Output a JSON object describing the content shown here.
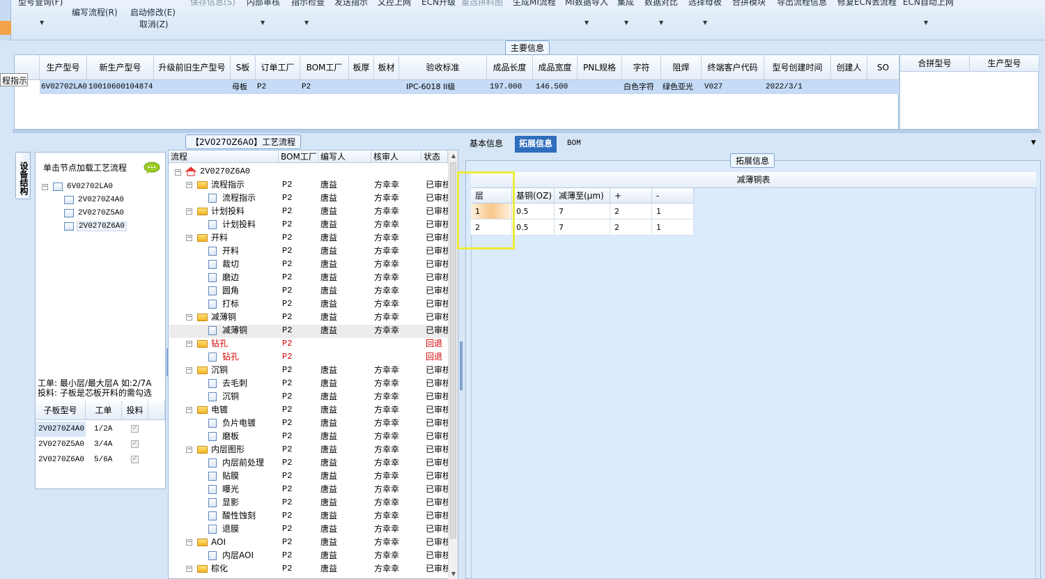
{
  "toolbar": {
    "items": [
      {
        "label": "型号查询(F)",
        "disabled": false
      },
      {
        "label": "编写流程(R)",
        "disabled": false
      },
      {
        "label": "启动修改(E)",
        "disabled": false
      },
      {
        "label": "取消(Z)",
        "disabled": false
      },
      {
        "label": "保存信息(S)",
        "disabled": true
      },
      {
        "label": "内部审核",
        "disabled": false
      },
      {
        "label": "指示检查",
        "disabled": false
      },
      {
        "label": "发送指示",
        "disabled": false
      },
      {
        "label": "文控上网",
        "disabled": false
      },
      {
        "label": "ECN升级",
        "disabled": false
      },
      {
        "label": "重选拼料图",
        "disabled": true
      },
      {
        "label": "生成MI流程",
        "disabled": false
      },
      {
        "label": "MI数据导入",
        "disabled": false
      },
      {
        "label": "集成",
        "disabled": false
      },
      {
        "label": "数据对比",
        "disabled": false
      },
      {
        "label": "选择母板",
        "disabled": false
      },
      {
        "label": "合拼模块",
        "disabled": false
      },
      {
        "label": "导出流程信息",
        "disabled": false
      },
      {
        "label": "修复ECN丢流程",
        "disabled": false
      },
      {
        "label": "ECN自动上网",
        "disabled": false
      }
    ]
  },
  "tooltip": "程指示",
  "main_section": {
    "title": "主要信息",
    "headers": [
      "生产型号",
      "新生产型号",
      "升级前旧生产型号",
      "S板",
      "订单工厂",
      "BOM工厂",
      "板厚",
      "板材",
      "验收标准",
      "成品长度",
      "成品宽度",
      "PNL规格",
      "字符",
      "阻焊",
      "终端客户代码",
      "型号创建时间",
      "创建人",
      "SO"
    ],
    "row": [
      "6V02702LA0",
      "10010600104874",
      "",
      "母板",
      "P2",
      "P2",
      "",
      "",
      "IPC-6018 II级",
      "197.000",
      "146.500",
      "",
      "白色字符",
      "绿色亚光",
      "V027",
      "2022/3/1",
      "",
      ""
    ]
  },
  "merge_section": {
    "headers": [
      "合拼型号",
      "生产型号"
    ]
  },
  "left_panel": {
    "tab_label": "设备结构",
    "load_label": "单击节点加载工艺流程",
    "tree": {
      "root": "6V02702LA0",
      "children": [
        "2V0270Z4A0",
        "2V0270Z5A0",
        "2V0270Z6A0"
      ]
    },
    "note_line1": "工单: 最小层/最大层A 如:2/7A",
    "note_line2": "投料: 子板是芯板开料的需勾选",
    "sub_headers": [
      "子板型号",
      "工单",
      "投料"
    ],
    "sub_rows": [
      {
        "model": "2V0270Z4A0",
        "order": "1/2A",
        "feed": true
      },
      {
        "model": "2V0270Z5A0",
        "order": "3/4A",
        "feed": true
      },
      {
        "model": "2V0270Z6A0",
        "order": "5/6A",
        "feed": true
      }
    ]
  },
  "flow_panel": {
    "title": "【2V0270Z6A0】工艺流程",
    "headers": [
      "流程",
      "BOM工厂",
      "编写人",
      "核审人",
      "状态"
    ],
    "root": "2V0270Z6A0",
    "rows": [
      {
        "name": "流程指示",
        "level": 1,
        "bom": "P2",
        "writer": "唐益",
        "reviewer": "方幸幸",
        "status": "已审核",
        "red": false
      },
      {
        "name": "流程指示",
        "level": 2,
        "bom": "P2",
        "writer": "唐益",
        "reviewer": "方幸幸",
        "status": "已审核",
        "red": false
      },
      {
        "name": "计划投料",
        "level": 1,
        "bom": "P2",
        "writer": "唐益",
        "reviewer": "方幸幸",
        "status": "已审核",
        "red": false
      },
      {
        "name": "计划投料",
        "level": 2,
        "bom": "P2",
        "writer": "唐益",
        "reviewer": "方幸幸",
        "status": "已审核",
        "red": false
      },
      {
        "name": "开料",
        "level": 1,
        "bom": "P2",
        "writer": "唐益",
        "reviewer": "方幸幸",
        "status": "已审核",
        "red": false
      },
      {
        "name": "开料",
        "level": 2,
        "bom": "P2",
        "writer": "唐益",
        "reviewer": "方幸幸",
        "status": "已审核",
        "red": false
      },
      {
        "name": "裁切",
        "level": 2,
        "bom": "P2",
        "writer": "唐益",
        "reviewer": "方幸幸",
        "status": "已审核",
        "red": false
      },
      {
        "name": "磨边",
        "level": 2,
        "bom": "P2",
        "writer": "唐益",
        "reviewer": "方幸幸",
        "status": "已审核",
        "red": false
      },
      {
        "name": "圆角",
        "level": 2,
        "bom": "P2",
        "writer": "唐益",
        "reviewer": "方幸幸",
        "status": "已审核",
        "red": false
      },
      {
        "name": "打标",
        "level": 2,
        "bom": "P2",
        "writer": "唐益",
        "reviewer": "方幸幸",
        "status": "已审核",
        "red": false
      },
      {
        "name": "减薄铜",
        "level": 1,
        "bom": "P2",
        "writer": "唐益",
        "reviewer": "方幸幸",
        "status": "已审核",
        "red": false
      },
      {
        "name": "减薄铜",
        "level": 2,
        "bom": "P2",
        "writer": "唐益",
        "reviewer": "方幸幸",
        "status": "已审核",
        "red": false
      },
      {
        "name": "钻孔",
        "level": 1,
        "bom": "P2",
        "writer": "",
        "reviewer": "",
        "status": "回退",
        "red": true
      },
      {
        "name": "钻孔",
        "level": 2,
        "bom": "P2",
        "writer": "",
        "reviewer": "",
        "status": "回退",
        "red": true
      },
      {
        "name": "沉铜",
        "level": 1,
        "bom": "P2",
        "writer": "唐益",
        "reviewer": "方幸幸",
        "status": "已审核",
        "red": false
      },
      {
        "name": "去毛刺",
        "level": 2,
        "bom": "P2",
        "writer": "唐益",
        "reviewer": "方幸幸",
        "status": "已审核",
        "red": false
      },
      {
        "name": "沉铜",
        "level": 2,
        "bom": "P2",
        "writer": "唐益",
        "reviewer": "方幸幸",
        "status": "已审核",
        "red": false
      },
      {
        "name": "电镀",
        "level": 1,
        "bom": "P2",
        "writer": "唐益",
        "reviewer": "方幸幸",
        "status": "已审核",
        "red": false
      },
      {
        "name": "负片电镀",
        "level": 2,
        "bom": "P2",
        "writer": "唐益",
        "reviewer": "方幸幸",
        "status": "已审核",
        "red": false
      },
      {
        "name": "磨板",
        "level": 2,
        "bom": "P2",
        "writer": "唐益",
        "reviewer": "方幸幸",
        "status": "已审核",
        "red": false
      },
      {
        "name": "内层图形",
        "level": 1,
        "bom": "P2",
        "writer": "唐益",
        "reviewer": "方幸幸",
        "status": "已审核",
        "red": false
      },
      {
        "name": "内层前处理",
        "level": 2,
        "bom": "P2",
        "writer": "唐益",
        "reviewer": "方幸幸",
        "status": "已审核",
        "red": false
      },
      {
        "name": "贴膜",
        "level": 2,
        "bom": "P2",
        "writer": "唐益",
        "reviewer": "方幸幸",
        "status": "已审核",
        "red": false
      },
      {
        "name": "曝光",
        "level": 2,
        "bom": "P2",
        "writer": "唐益",
        "reviewer": "方幸幸",
        "status": "已审核",
        "red": false
      },
      {
        "name": "显影",
        "level": 2,
        "bom": "P2",
        "writer": "唐益",
        "reviewer": "方幸幸",
        "status": "已审核",
        "red": false
      },
      {
        "name": "酸性蚀刻",
        "level": 2,
        "bom": "P2",
        "writer": "唐益",
        "reviewer": "方幸幸",
        "status": "已审核",
        "red": false
      },
      {
        "name": "退膜",
        "level": 2,
        "bom": "P2",
        "writer": "唐益",
        "reviewer": "方幸幸",
        "status": "已审核",
        "red": false
      },
      {
        "name": "AOI",
        "level": 1,
        "bom": "P2",
        "writer": "唐益",
        "reviewer": "方幸幸",
        "status": "已审核",
        "red": false
      },
      {
        "name": "内层AOI",
        "level": 2,
        "bom": "P2",
        "writer": "唐益",
        "reviewer": "方幸幸",
        "status": "已审核",
        "red": false
      },
      {
        "name": "棕化",
        "level": 1,
        "bom": "P2",
        "writer": "唐益",
        "reviewer": "方幸幸",
        "status": "已审核",
        "red": false
      }
    ]
  },
  "right_panel": {
    "tabs": [
      "基本信息",
      "拓展信息",
      "BOM"
    ],
    "active_tab": "拓展信息",
    "section_title": "拓展信息",
    "table_caption": "减薄铜表",
    "table_headers": [
      "层",
      "基铜(OZ)",
      "减薄至(μm)",
      "+",
      "-"
    ],
    "table_rows": [
      [
        "1",
        "0.5",
        "7",
        "2",
        "1"
      ],
      [
        "2",
        "0.5",
        "7",
        "2",
        "1"
      ]
    ]
  }
}
